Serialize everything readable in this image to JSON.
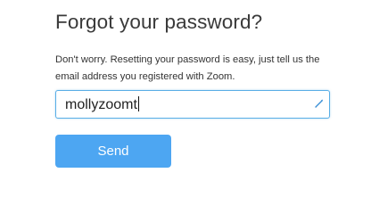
{
  "form": {
    "title": "Forgot your password?",
    "description": "Don't worry. Resetting your password is easy, just tell us the email address you registered with Zoom.",
    "username_value": "mollyzoomt",
    "send_label": "Send"
  },
  "icons": {
    "field_icon": "pen-icon"
  },
  "colors": {
    "accent": "#4da6f2",
    "field_border": "#5aaee6",
    "title_text": "#3a3a3a",
    "body_text": "#333333"
  }
}
